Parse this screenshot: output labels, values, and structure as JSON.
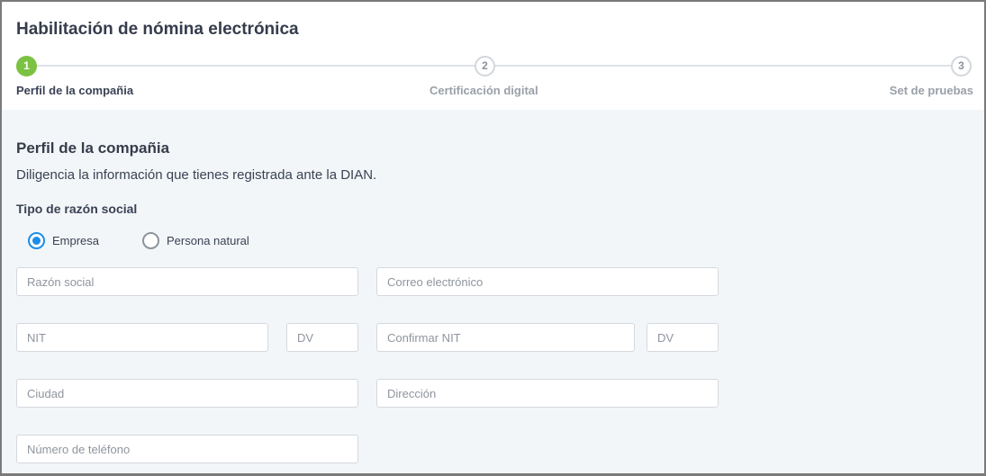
{
  "title": "Habilitación de nómina electrónica",
  "steps": [
    {
      "number": "1",
      "label": "Perfil de la compañia",
      "active": true
    },
    {
      "number": "2",
      "label": "Certificación digital",
      "active": false
    },
    {
      "number": "3",
      "label": "Set de pruebas",
      "active": false
    }
  ],
  "section": {
    "title": "Perfil de la compañia",
    "description": "Diligencia la información que tienes registrada ante la DIAN."
  },
  "razon_social_type": {
    "label": "Tipo de razón social",
    "options": [
      {
        "label": "Empresa",
        "checked": true
      },
      {
        "label": "Persona natural",
        "checked": false
      }
    ]
  },
  "fields": {
    "razon_social": {
      "placeholder": "Razón social",
      "value": ""
    },
    "correo": {
      "placeholder": "Correo electrónico",
      "value": ""
    },
    "nit": {
      "placeholder": "NIT",
      "value": ""
    },
    "dv": {
      "placeholder": "DV",
      "value": ""
    },
    "confirmar_nit": {
      "placeholder": "Confirmar NIT",
      "value": ""
    },
    "confirmar_dv": {
      "placeholder": "DV",
      "value": ""
    },
    "ciudad": {
      "placeholder": "Ciudad",
      "value": ""
    },
    "direccion": {
      "placeholder": "Dirección",
      "value": ""
    },
    "telefono": {
      "placeholder": "Número de teléfono",
      "value": ""
    }
  },
  "colors": {
    "step_active": "#7cc242",
    "radio_checked": "#1d8ce6",
    "content_background": "#f3f6f8"
  }
}
